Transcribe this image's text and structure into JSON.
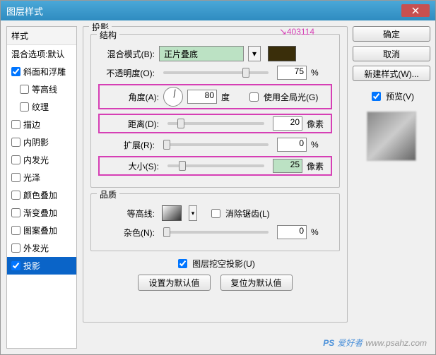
{
  "window": {
    "title": "图层样式"
  },
  "sidebar": {
    "style_header": "样式",
    "blend_default": "混合选项:默认",
    "items": [
      {
        "label": "斜面和浮雕",
        "checked": true
      },
      {
        "label": "等高线",
        "checked": false,
        "indent": true
      },
      {
        "label": "纹理",
        "checked": false,
        "indent": true
      },
      {
        "label": "描边",
        "checked": false
      },
      {
        "label": "内阴影",
        "checked": false
      },
      {
        "label": "内发光",
        "checked": false
      },
      {
        "label": "光泽",
        "checked": false
      },
      {
        "label": "颜色叠加",
        "checked": false
      },
      {
        "label": "渐变叠加",
        "checked": false
      },
      {
        "label": "图案叠加",
        "checked": false
      },
      {
        "label": "外发光",
        "checked": false
      },
      {
        "label": "投影",
        "checked": true,
        "selected": true
      }
    ]
  },
  "main": {
    "panel_title": "投影",
    "structure_title": "结构",
    "quality_title": "品质",
    "blend_mode_label": "混合模式(B):",
    "blend_mode_value": "正片叠底",
    "shadow_color": "#3a2e0a",
    "opacity_label": "不透明度(O):",
    "opacity_value": "75",
    "opacity_unit": "%",
    "angle_label": "角度(A):",
    "angle_value": "80",
    "angle_unit": "度",
    "global_light_label": "使用全局光(G)",
    "distance_label": "距离(D):",
    "distance_value": "20",
    "distance_unit": "像素",
    "spread_label": "扩展(R):",
    "spread_value": "0",
    "spread_unit": "%",
    "size_label": "大小(S):",
    "size_value": "25",
    "size_unit": "像素",
    "contour_label": "等高线:",
    "antialias_label": "消除锯齿(L)",
    "noise_label": "杂色(N):",
    "noise_value": "0",
    "noise_unit": "%",
    "knockout_label": "图层挖空投影(U)",
    "set_default": "设置为默认值",
    "reset_default": "复位为默认值",
    "annotation": "403114"
  },
  "right": {
    "ok": "确定",
    "cancel": "取消",
    "new_style": "新建样式(W)...",
    "preview": "预览(V)"
  },
  "watermark": {
    "ps": "PS",
    "text": "爱好者",
    "url": "www.psahz.com"
  }
}
